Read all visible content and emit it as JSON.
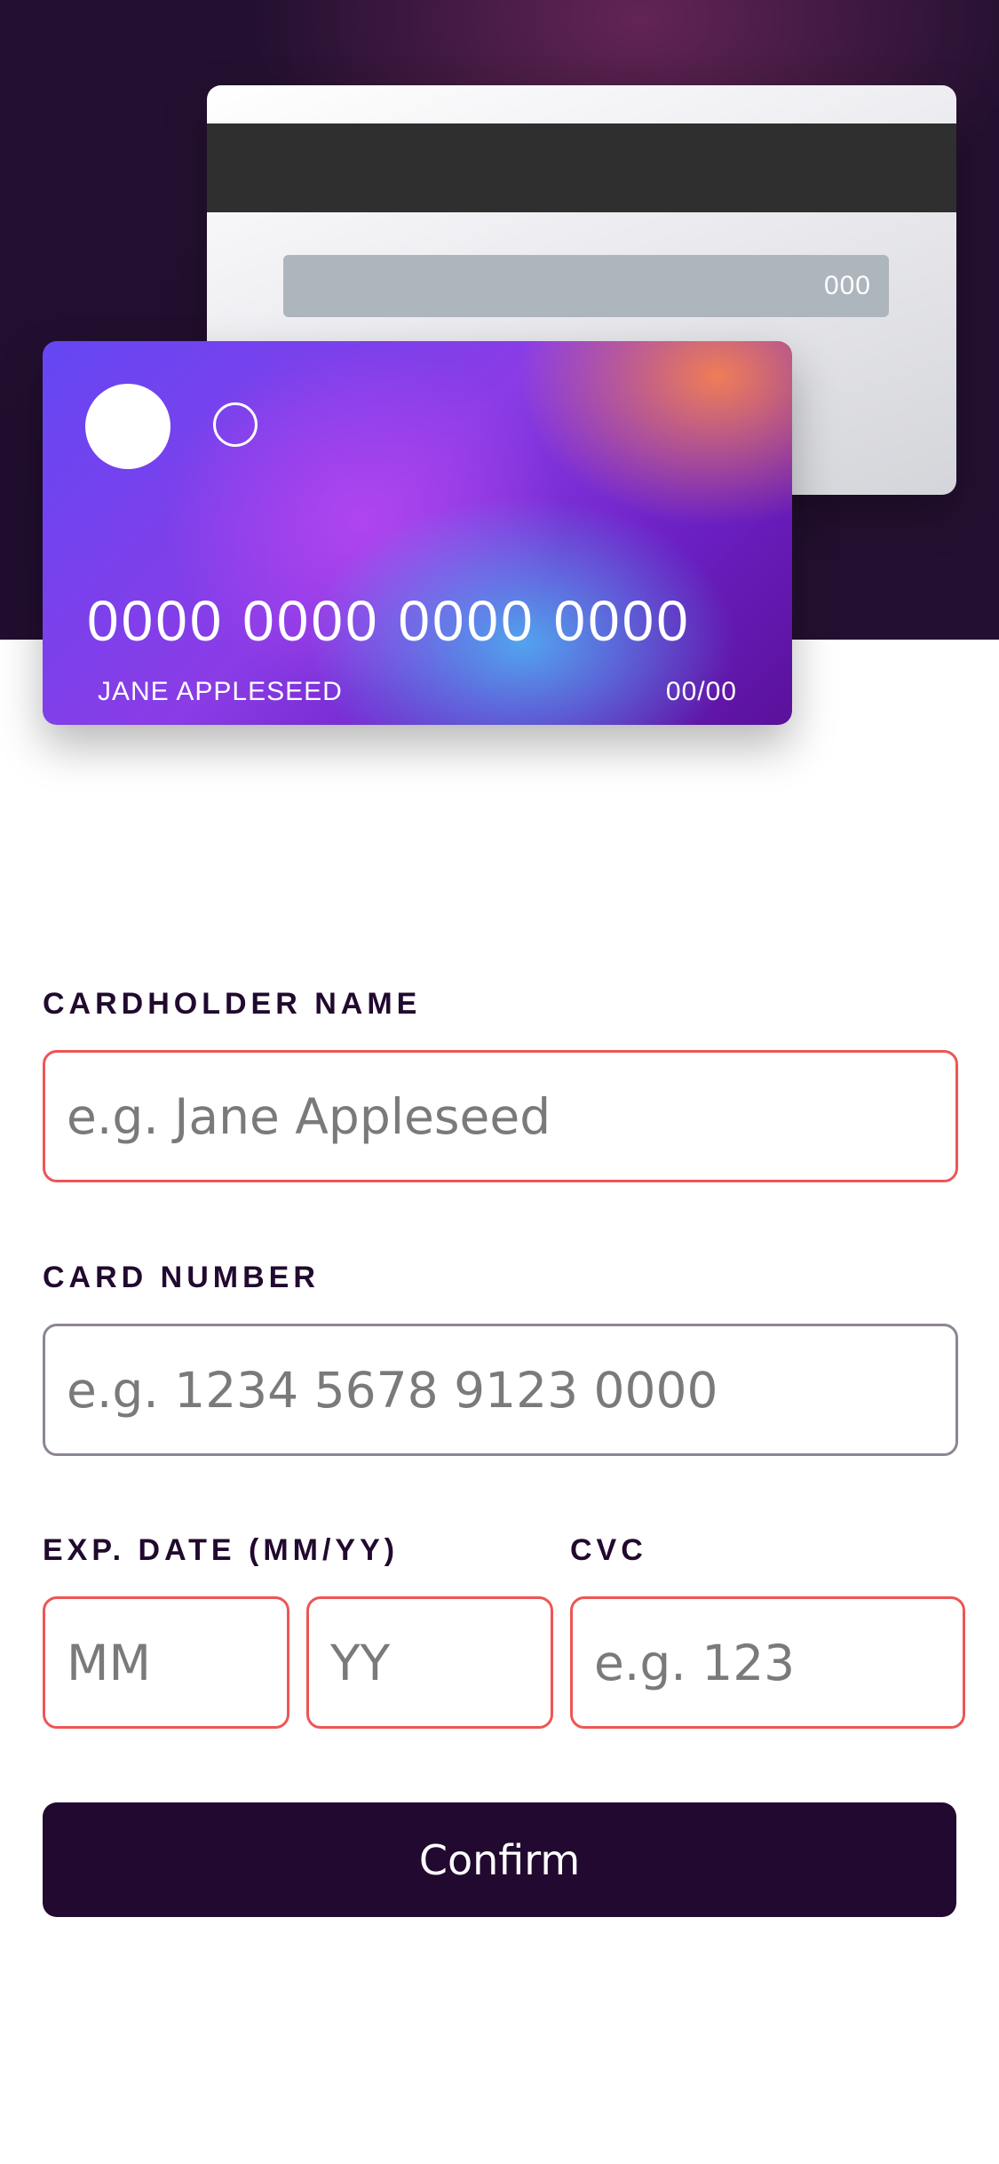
{
  "card_back": {
    "cvc": "000"
  },
  "card_front": {
    "number": "0000 0000 0000 0000",
    "holder": "JANE APPLESEED",
    "expiry": "00/00"
  },
  "form": {
    "cardholder_label": "CARDHOLDER NAME",
    "cardholder_placeholder": "e.g. Jane Appleseed",
    "number_label": "CARD NUMBER",
    "number_placeholder": "e.g. 1234 5678 9123 0000",
    "exp_label": "EXP. DATE (MM/YY)",
    "month_placeholder": "MM",
    "year_placeholder": "YY",
    "cvc_label": "CVC",
    "cvc_placeholder": "e.g. 123",
    "confirm_label": "Confirm"
  },
  "colors": {
    "dark_violet": "#21092f",
    "error_red": "#ee5555",
    "border_gray": "#8e8593"
  }
}
